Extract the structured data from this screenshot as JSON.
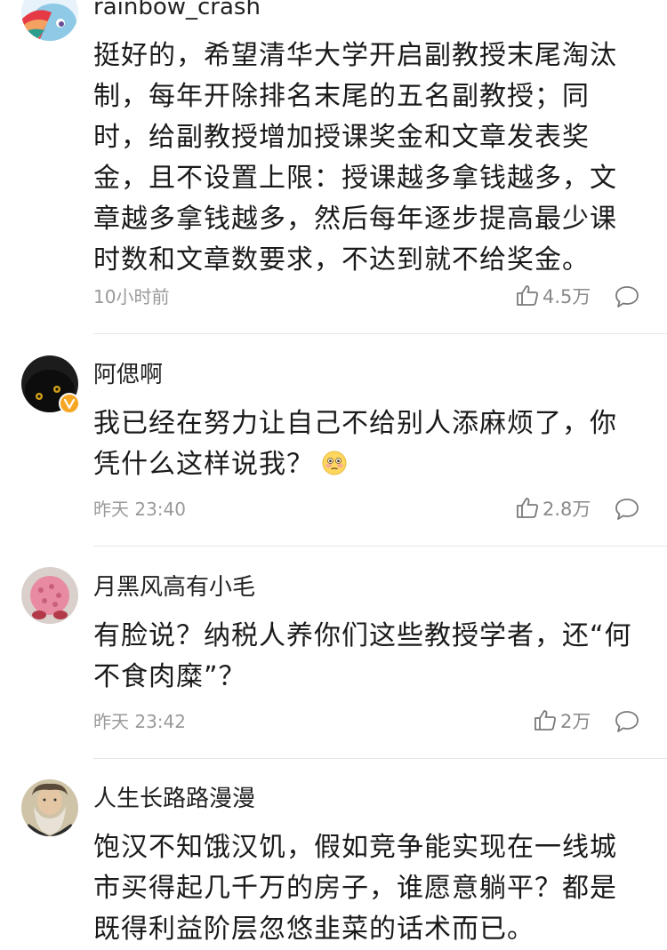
{
  "comments": [
    {
      "username": "rainbow_crash",
      "lines": [
        "挺好的，希望清华大学开启副教授末尾淘汰",
        "制，每年开除排名末尾的五名副教授；同",
        "时，给副教授增加授课奖金和文章发表奖",
        "金，且不设置上限：授课越多拿钱越多，文",
        "章越多拿钱越多，然后每年逐步提高最少课",
        "时数和文章数要求，不达到就不给奖金。"
      ],
      "time": "10小时前",
      "likes": "4.5万",
      "verified": false
    },
    {
      "username": "阿偲啊",
      "lines": [
        "我已经在努力让自己不给别人添麻烦了，你",
        "凭什么这样说我？"
      ],
      "emoji": "flushed-emoji",
      "time": "昨天 23:40",
      "likes": "2.8万",
      "verified": true
    },
    {
      "username": "月黑风高有小毛",
      "lines": [
        "有脸说？纳税人养你们这些教授学者，还“何",
        "不食肉糜”？"
      ],
      "time": "昨天 23:42",
      "likes": "2万",
      "verified": false
    },
    {
      "username": "人生长路路漫漫",
      "lines": [
        "饱汉不知饿汉饥，假如竞争能实现在一线城",
        "市买得起几千万的房子，谁愿意躺平？都是",
        "既得利益阶层忽悠韭菜的话术而已。"
      ],
      "time": "",
      "likes": "",
      "verified": false
    }
  ],
  "icons": {
    "like": "thumbs-up-icon",
    "reply": "comment-bubble-icon",
    "verified": "verified-badge-icon"
  },
  "colors": {
    "text": "#1a1a1a",
    "meta": "#9a9a9a",
    "divider": "#e6e6e6",
    "verified": "#f5a623"
  }
}
